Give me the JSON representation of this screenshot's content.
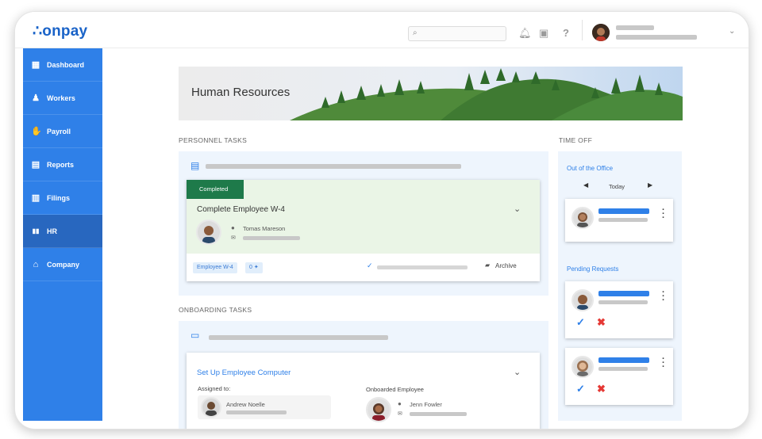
{
  "app": {
    "logo": "onpay",
    "search_icon": "search-icon"
  },
  "sidebar": {
    "items": [
      {
        "label": "Dashboard",
        "icon": "▦"
      },
      {
        "label": "Workers",
        "icon": "♟"
      },
      {
        "label": "Payroll",
        "icon": "✋"
      },
      {
        "label": "Reports",
        "icon": "▤"
      },
      {
        "label": "Filings",
        "icon": "▥"
      },
      {
        "label": "HR",
        "icon": "▮▮"
      },
      {
        "label": "Company",
        "icon": "⌂"
      }
    ]
  },
  "banner": {
    "title": "Human Resources"
  },
  "personnel": {
    "heading": "PERSONNEL TASKS",
    "status": "Completed",
    "task_title": "Complete Employee W-4",
    "person_name": "Tomas Mareson",
    "tag_label": "Employee W-4",
    "comment_count": "0",
    "archive_label": "Archive"
  },
  "onboarding": {
    "heading": "ONBOARDING TASKS",
    "task_title": "Set Up Employee Computer",
    "assigned_label": "Assigned to:",
    "assigned_name": "Andrew Noelle",
    "onboarded_label": "Onboarded Employee",
    "onboarded_name": "Jenn Fowler"
  },
  "timeoff": {
    "heading": "TIME OFF",
    "out_label": "Out of the Office",
    "day_label": "Today",
    "pending_label": "Pending Requests"
  },
  "colors": {
    "primary": "#2f80e8",
    "active": "#2867bf",
    "completed": "#1e7a4a",
    "panel": "#eef5fd"
  }
}
